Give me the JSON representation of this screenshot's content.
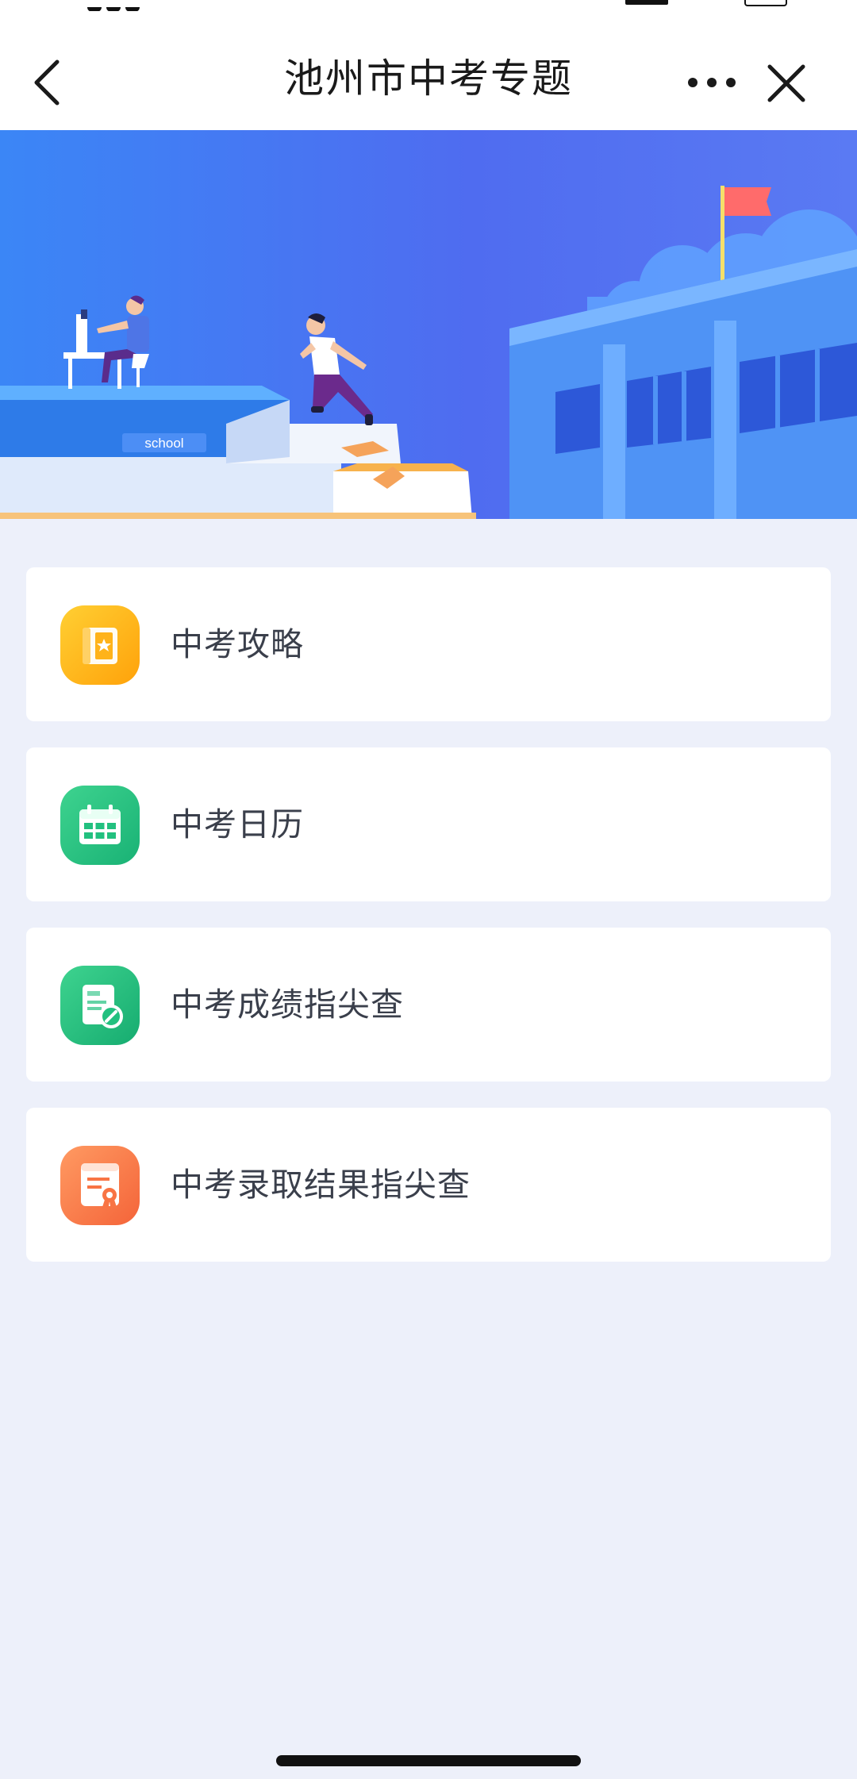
{
  "header": {
    "title": "池州市中考专题"
  },
  "banner": {
    "sign_text": "school"
  },
  "menu": {
    "items": [
      {
        "label": "中考攻略",
        "icon": "guide-book-icon",
        "color": "#ffb31a"
      },
      {
        "label": "中考日历",
        "icon": "calendar-icon",
        "color": "#22c07f"
      },
      {
        "label": "中考成绩指尖查",
        "icon": "score-query-icon",
        "color": "#22c07f"
      },
      {
        "label": "中考录取结果指尖查",
        "icon": "admission-result-icon",
        "color": "#f87444"
      }
    ]
  },
  "colors": {
    "nav_background": "#ffffff",
    "page_background": "#edf0fa",
    "banner_blue": "#3f7cf3"
  }
}
